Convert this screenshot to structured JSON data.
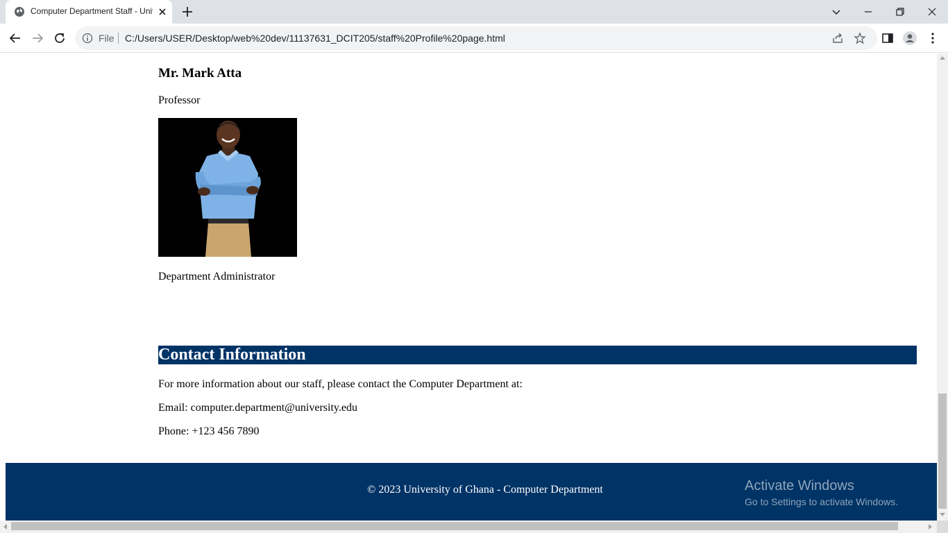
{
  "browser": {
    "tab_title": "Computer Department Staff - University of Ghana",
    "url_scheme": "File",
    "url": "C:/Users/USER/Desktop/web%20dev/11137631_DCIT205/staff%20Profile%20page.html",
    "icons": [
      "globe-icon",
      "close-icon",
      "plus-icon",
      "chevron-down-icon",
      "minimize-icon",
      "restore-icon",
      "close-window-icon",
      "back-arrow-icon",
      "forward-arrow-icon",
      "reload-icon",
      "info-icon",
      "share-icon",
      "star-icon",
      "side-panel-icon",
      "profile-icon",
      "menu-dots-icon"
    ]
  },
  "staff": {
    "name": "Mr. Mark Atta",
    "title": "Professor",
    "role": "Department Administrator"
  },
  "contact": {
    "heading": "Contact Information",
    "intro": "For more information about our staff, please contact the Computer Department at:",
    "email": "Email: computer.department@university.edu",
    "phone": "Phone: +123 456 7890"
  },
  "footer": {
    "text": "© 2023 University of Ghana - Computer Department"
  },
  "watermark": {
    "line1": "Activate Windows",
    "line2": "Go to Settings to activate Windows."
  },
  "colors": {
    "brand_navy": "#003366",
    "chrome_bg": "#dee1e6"
  }
}
